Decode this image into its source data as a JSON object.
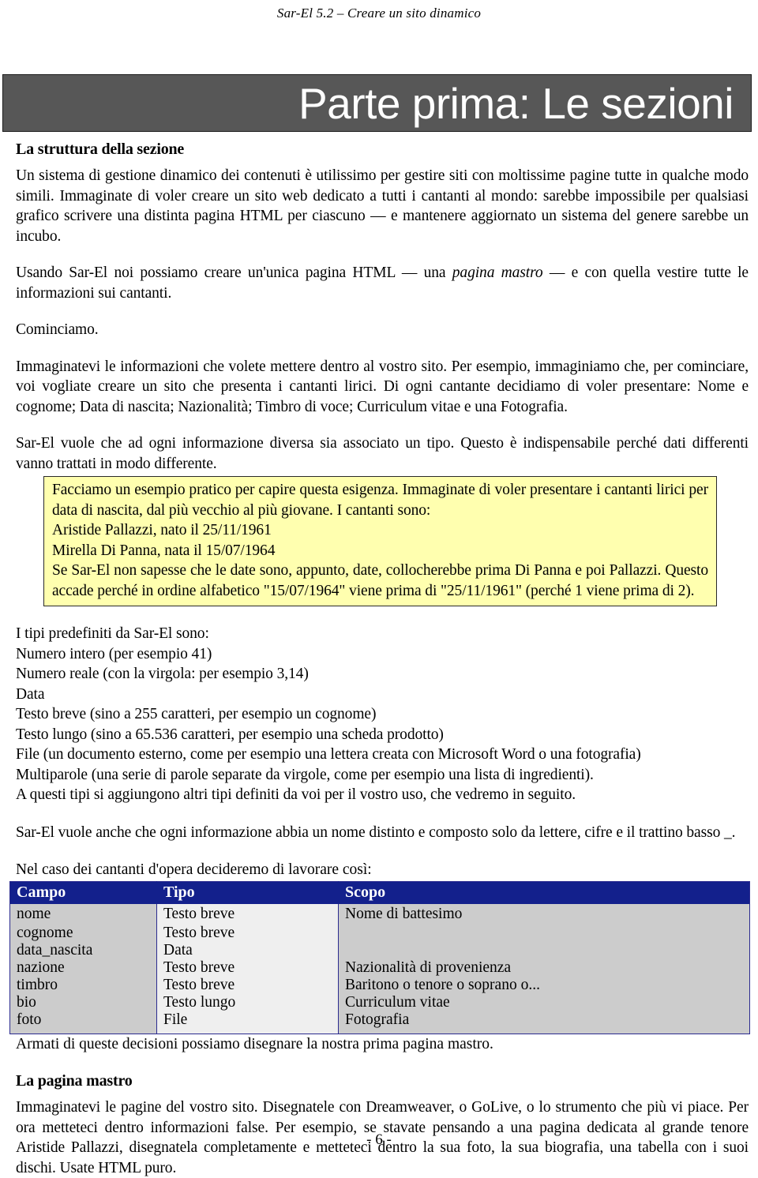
{
  "header": {
    "running_title": "Sar-El 5.2 – Creare un sito dinamico"
  },
  "banner": {
    "title": "Parte prima: Le sezioni",
    "background_color": "#575757",
    "text_color": "#ffffff"
  },
  "sections": {
    "struttura": {
      "heading": "La struttura della sezione",
      "p1_a": "Un sistema di gestione dinamico dei contenuti è utilissimo per gestire siti con moltissime pagine tutte in qualche modo simili. ",
      "p1_b": "Immaginate di voler creare un sito web dedicato a tutti i cantanti al mondo: sarebbe impossibile per qualsiasi grafico scrivere una distinta pagina HTML per ciascuno — e mantenere aggiornato un sistema del genere sarebbe un incubo.",
      "p2_a": "Usando Sar-El noi possiamo creare un'unica pagina HTML — una ",
      "p2_em": "pagina mastro",
      "p2_b": " — e con quella vestire tutte le informazioni sui cantanti.",
      "p3": "Cominciamo.",
      "p4": "Immaginatevi le informazioni che volete mettere dentro al vostro sito. Per esempio, immaginiamo che, per cominciare, voi vogliate creare un sito che presenta i cantanti lirici. Di ogni cantante decidiamo di voler presentare: Nome e cognome; Data di nascita; Nazionalità; Timbro di voce; Curriculum vitae e una Fotografia.",
      "p5": "Sar-El vuole che ad ogni informazione diversa sia associato un tipo. Questo è indispensabile perché dati differenti vanno trattati in modo differente."
    },
    "callout": {
      "background_color": "#ffffaf",
      "border_color": "#2a2a2a",
      "lines": [
        "Facciamo un esempio pratico per capire questa esigenza. Immaginate di voler presentare i cantanti lirici per data di nascita, dal più vecchio al più giovane. I cantanti sono:",
        "Aristide Pallazzi, nato il 25/11/1961",
        "Mirella Di Panna, nata il 15/07/1964",
        "Se Sar-El non sapesse che le date sono, appunto, date, collocherebbe prima Di Panna e poi Pallazzi. Questo accade perché in ordine alfabetico \"15/07/1964\" viene prima di \"25/11/1961\" (perché 1 viene prima di 2)."
      ]
    },
    "tipi": {
      "lines": [
        "I tipi predefiniti da Sar-El sono:",
        "Numero intero (per esempio 41)",
        "Numero reale (con la virgola: per esempio 3,14)",
        "Data",
        "Testo breve (sino a 255 caratteri, per esempio un cognome)",
        "Testo lungo (sino a 65.536 caratteri, per esempio una scheda prodotto)",
        "File (un documento esterno, come per esempio una lettera creata con Microsoft Word o una fotografia)",
        "Multiparole (una serie di parole separate da virgole, come per esempio una lista di ingredienti).",
        "A questi tipi si aggiungono altri tipi definiti da voi per il vostro uso, che vedremo in seguito."
      ]
    },
    "nomi": {
      "p1": "Sar-El vuole anche che ogni informazione abbia un nome distinto e composto solo da lettere, cifre e il trattino basso _."
    },
    "table_block": {
      "intro": "Nel caso dei cantanti d'opera decideremo di lavorare così:",
      "after": "Armati di queste decisioni possiamo disegnare la nostra prima pagina mastro."
    },
    "mastro": {
      "heading": "La pagina mastro",
      "p1": "Immaginatevi le pagine del vostro sito. Disegnatele con Dreamweaver, o GoLive, o lo strumento che più vi piace. Per ora metteteci dentro informazioni false. Per esempio, se stavate pensando a una pagina dedicata al grande tenore Aristide Pallazzi, disegnatela completamente e metteteci dentro la sua foto, la sua biografia, una tabella con i suoi dischi. Usate HTML puro."
    }
  },
  "fields_table": {
    "header_bg": "#13208c",
    "header_text_color": "#ffffff",
    "columns": [
      "Campo",
      "Tipo",
      "Scopo"
    ],
    "rows": [
      {
        "campo": "nome",
        "tipo": "Testo breve",
        "scopo": "Nome di battesimo"
      },
      {
        "campo": "cognome",
        "tipo": "Testo breve",
        "scopo": ""
      },
      {
        "campo": "data_nascita",
        "tipo": "Data",
        "scopo": ""
      },
      {
        "campo": "nazione",
        "tipo": "Testo breve",
        "scopo": "Nazionalità di provenienza"
      },
      {
        "campo": "timbro",
        "tipo": "Testo breve",
        "scopo": "Baritono o tenore o soprano o..."
      },
      {
        "campo": "bio",
        "tipo": "Testo lungo",
        "scopo": "Curriculum vitae"
      },
      {
        "campo": "foto",
        "tipo": "File",
        "scopo": "Fotografia"
      }
    ]
  },
  "footer": {
    "page_number": "- 6 -"
  }
}
